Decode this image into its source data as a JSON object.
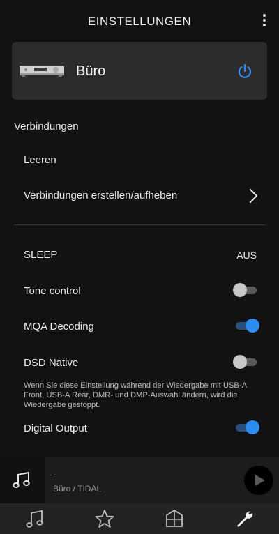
{
  "header": {
    "title": "EINSTELLUNGEN",
    "menu_icon": "more-vertical-icon"
  },
  "device": {
    "name": "Büro",
    "icon": "amplifier-device-icon",
    "power_icon": "power-icon",
    "accent": "#2d8cf0"
  },
  "connections": {
    "section_label": "Verbindungen",
    "items": [
      {
        "label": "Leeren"
      },
      {
        "label": "Verbindungen erstellen/aufheben",
        "icon": "chevron-right-icon"
      }
    ]
  },
  "settings": {
    "sleep": {
      "label": "SLEEP",
      "value": "AUS"
    },
    "tone_control": {
      "label": "Tone control",
      "enabled": false
    },
    "mqa_decoding": {
      "label": "MQA Decoding",
      "enabled": true
    },
    "dsd_native": {
      "label": "DSD Native",
      "enabled": false
    },
    "dsd_note": "Wenn Sie diese Einstellung während der Wiedergabe mit USB-A Front, USB-A Rear, DMR- und DMP-Auswahl ändern, wird die Wiedergabe gestoppt.",
    "digital_output": {
      "label": "Digital Output",
      "enabled": true
    }
  },
  "player": {
    "title": "-",
    "subtitle": "Büro / TIDAL",
    "art_icon": "music-note-icon",
    "play_icon": "play-icon"
  },
  "tabbar": {
    "tabs": [
      {
        "name": "music",
        "icon": "music-note-icon"
      },
      {
        "name": "favorites",
        "icon": "star-icon"
      },
      {
        "name": "home",
        "icon": "home-icon"
      },
      {
        "name": "settings",
        "icon": "wrench-icon",
        "active": true
      }
    ]
  }
}
